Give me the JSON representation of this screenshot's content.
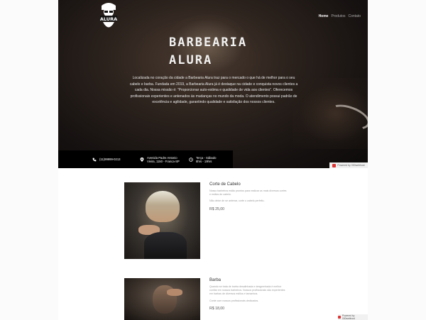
{
  "brand": {
    "logo_text": "ALURA"
  },
  "nav": {
    "items": [
      "Home",
      "Produtos",
      "Contato"
    ],
    "active": "Home"
  },
  "hero": {
    "title_line1": "BARBEARIA",
    "title_line2": "ALURA",
    "description": "Localizada no coração da cidade a Barbearia Alura traz para o mercado o que há de melhor para o seu cabelo e barba. Fundada em 2019, a Barbearia Alura já é destaque na cidade e conquista novos clientes a cada dia. Nossa missão é: \"Proporcionar auto-estima e qualidade de vida aos clientes\". Oferecemos profissionais experientes e antenados às mudanças no mundo da moda. O atendimento possui padrão de excelência e agilidade, garantindo qualidade e satisfação dos nossos clientes."
  },
  "info": {
    "phone": "(11)99999-0213",
    "address_line1": "Avenida Padre Antonio",
    "address_line2": "Vieira, 1150 - Franca-SP",
    "hours_line1": "Terça - Sábado",
    "hours_line2": "8hrs - 19hrs"
  },
  "badges": {
    "top": "Powered by 000webhost",
    "bottom": "Powered by 000webhost"
  },
  "products": [
    {
      "title": "Corte de Cabelo",
      "desc": "Nosso barbeiros estão prontos para realizar os mais diversos cortes e estilos de cabelo.",
      "desc2": "Não deixe de se antenar, corte o cabelo perfeito.",
      "price": "R$ 25,00"
    },
    {
      "title": "Barba",
      "desc": "Quando se trata de barba desalinhada e desgrenhada é melhor confiar em nossos barbeiros. Nossos profissionais são experientes em barbas de diversos estilos e tamanhos.",
      "desc2": "Conte com nossos profissionais dedicados.",
      "price": "R$ 18,00"
    }
  ],
  "colors": {
    "accent_red": "#dd3333",
    "hero_dark": "#151110",
    "infobar": "#000000"
  }
}
